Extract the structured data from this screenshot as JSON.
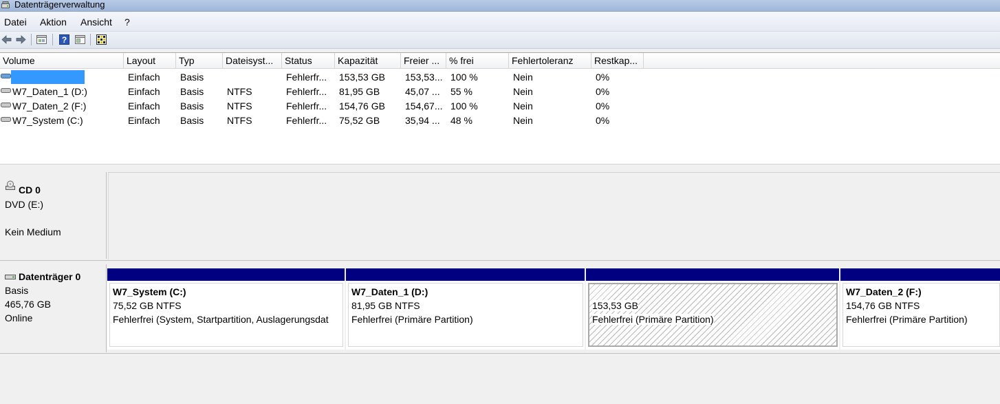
{
  "window": {
    "title": "Datenträgerverwaltung"
  },
  "menu": [
    "Datei",
    "Aktion",
    "Ansicht",
    "?"
  ],
  "toolbar": {
    "icons": [
      "back-arrow-icon",
      "forward-arrow-icon",
      "disk-list-icon",
      "help-icon",
      "properties-icon",
      "settings-icon"
    ]
  },
  "volumes": {
    "columns": [
      "Volume",
      "Layout",
      "Typ",
      "Dateisyst...",
      "Status",
      "Kapazität",
      "Freier ...",
      "% frei",
      "Fehlertoleranz",
      "Restkap..."
    ],
    "rows": [
      [
        "",
        "Einfach",
        "Basis",
        "",
        "Fehlerfr...",
        "153,53 GB",
        "153,53...",
        "100 %",
        "Nein",
        "0%"
      ],
      [
        "W7_Daten_1 (D:)",
        "Einfach",
        "Basis",
        "NTFS",
        "Fehlerfr...",
        "81,95 GB",
        "45,07 ...",
        "55 %",
        "Nein",
        "0%"
      ],
      [
        "W7_Daten_2 (F:)",
        "Einfach",
        "Basis",
        "NTFS",
        "Fehlerfr...",
        "154,76 GB",
        "154,67...",
        "100 %",
        "Nein",
        "0%"
      ],
      [
        "W7_System (C:)",
        "Einfach",
        "Basis",
        "NTFS",
        "Fehlerfr...",
        "75,52 GB",
        "35,94 ...",
        "48 %",
        "Nein",
        "0%"
      ]
    ]
  },
  "disks": {
    "cd": {
      "name": "CD 0",
      "type": "DVD (E:)",
      "status": "Kein Medium"
    },
    "disk0": {
      "name": "Datenträger 0",
      "type": "Basis",
      "size": "465,76 GB",
      "status": "Online",
      "partitions": [
        {
          "name": "W7_System  (C:)",
          "size": "75,52 GB NTFS",
          "status": "Fehlerfrei (System, Startpartition, Auslagerungsdat"
        },
        {
          "name": "W7_Daten_1  (D:)",
          "size": "81,95 GB NTFS",
          "status": "Fehlerfrei (Primäre Partition)"
        },
        {
          "name": "",
          "size": "153,53 GB",
          "status": "Fehlerfrei (Primäre Partition)"
        },
        {
          "name": "W7_Daten_2  (F:)",
          "size": "154,76 GB NTFS",
          "status": "Fehlerfrei (Primäre Partition)"
        }
      ]
    }
  },
  "colors": {
    "partition_bar": "#000080",
    "selection": "#3399ff"
  }
}
